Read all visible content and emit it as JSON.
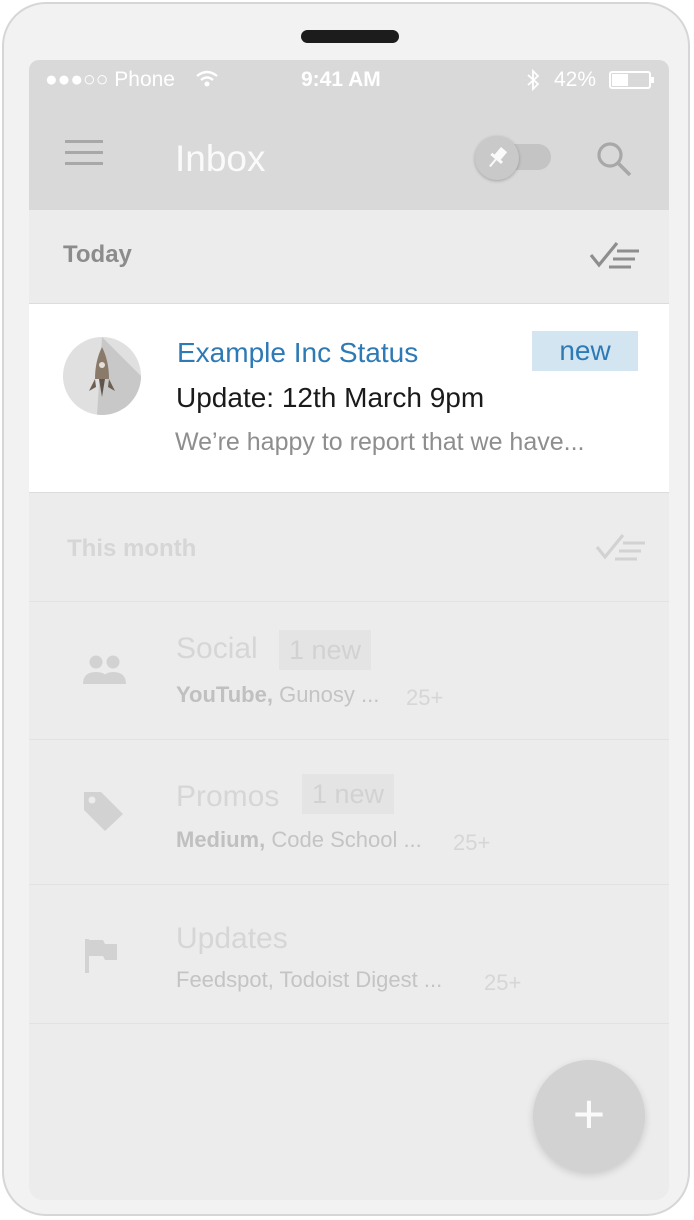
{
  "status_bar": {
    "carrier": "●●●○○ Phone",
    "time": "9:41 AM",
    "battery": "42%",
    "icons": [
      "wifi-icon",
      "bluetooth-icon",
      "battery-icon"
    ]
  },
  "app_bar": {
    "title": "Inbox",
    "icons": [
      "menu-icon",
      "pin-icon",
      "search-icon"
    ]
  },
  "today": {
    "header": "Today",
    "message": {
      "sender": "Example Inc Status",
      "badge": "new",
      "subject": "Update: 12th March 9pm",
      "snippet": "We’re happy to report that we have..."
    }
  },
  "this_month": {
    "header": "This month",
    "bundles": [
      {
        "icon": "people-icon",
        "name": "Social",
        "badge": "1 new",
        "senders_bold": "YouTube,",
        "senders_rest": "Gunosy ...",
        "count": "25+"
      },
      {
        "icon": "tag-icon",
        "name": "Promos",
        "badge": "1 new",
        "senders_bold": "Medium,",
        "senders_rest": "Code School ...",
        "count": "25+"
      },
      {
        "icon": "flag-icon",
        "name": "Updates",
        "badge": "",
        "senders_bold": "",
        "senders_rest": "Feedspot, Todoist Digest ...",
        "count": "25+"
      }
    ]
  },
  "fab": {
    "label": "+"
  },
  "colors": {
    "accent": "#2e7ab5",
    "badge_bg": "#d4e5f2",
    "background": "#ececec",
    "card": "#ffffff"
  }
}
